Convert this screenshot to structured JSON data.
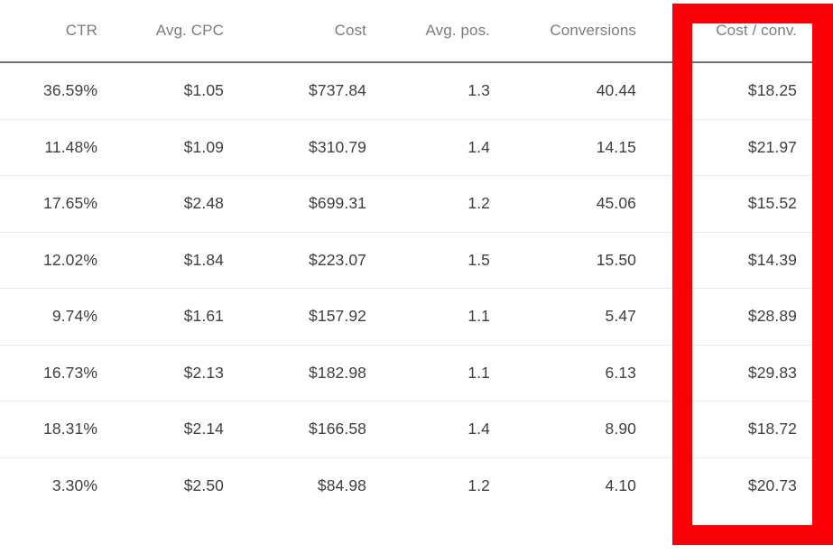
{
  "table": {
    "columns": [
      {
        "key": "ctr",
        "label": "CTR"
      },
      {
        "key": "avg_cpc",
        "label": "Avg. CPC"
      },
      {
        "key": "cost",
        "label": "Cost"
      },
      {
        "key": "avg_pos",
        "label": "Avg. pos."
      },
      {
        "key": "conversions",
        "label": "Conversions"
      },
      {
        "key": "cost_conv",
        "label": "Cost / conv."
      }
    ],
    "rows": [
      [
        "36.59%",
        "$1.05",
        "$737.84",
        "1.3",
        "40.44",
        "$18.25"
      ],
      [
        "11.48%",
        "$1.09",
        "$310.79",
        "1.4",
        "14.15",
        "$21.97"
      ],
      [
        "17.65%",
        "$2.48",
        "$699.31",
        "1.2",
        "45.06",
        "$15.52"
      ],
      [
        "12.02%",
        "$1.84",
        "$223.07",
        "1.5",
        "15.50",
        "$14.39"
      ],
      [
        "9.74%",
        "$1.61",
        "$157.92",
        "1.1",
        "5.47",
        "$28.89"
      ],
      [
        "16.73%",
        "$2.13",
        "$182.98",
        "1.1",
        "6.13",
        "$29.83"
      ],
      [
        "18.31%",
        "$2.14",
        "$166.58",
        "1.4",
        "8.90",
        "$18.72"
      ],
      [
        "3.30%",
        "$2.50",
        "$84.98",
        "1.2",
        "4.10",
        "$20.73"
      ]
    ]
  },
  "annotation": {
    "highlight_color": "#fb0007",
    "highlighted_column": "Cost / conv."
  },
  "theme": {
    "background": "#ffffff",
    "header_text": "#7a7d80",
    "cell_text": "#3c4043",
    "header_rule": "#6f6f6f",
    "row_rule": "#e9e9e9"
  }
}
